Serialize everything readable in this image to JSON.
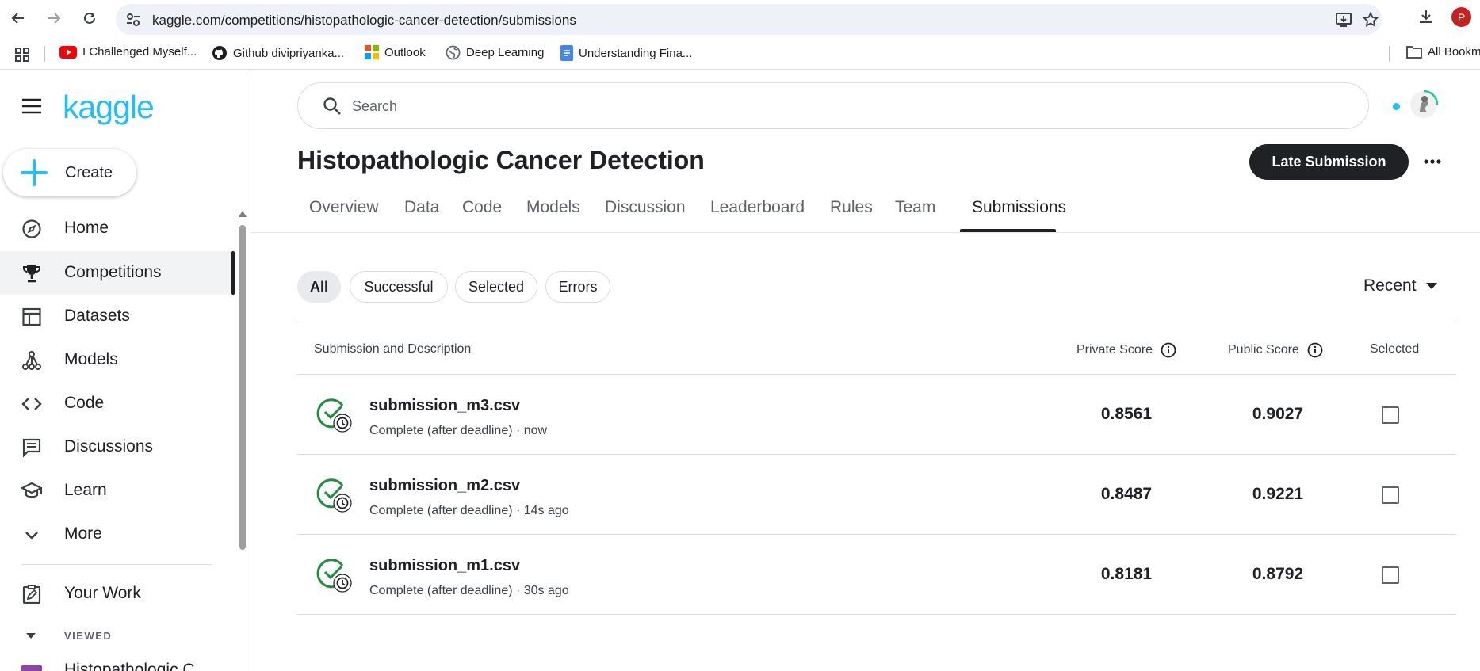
{
  "browser": {
    "url": "kaggle.com/competitions/histopathologic-cancer-detection/submissions",
    "profile_initial": "P",
    "bookmarks": [
      {
        "label": "I Challenged Myself...",
        "icon": "youtube-icon"
      },
      {
        "label": "Github divipriyanka...",
        "icon": "github-icon"
      },
      {
        "label": "Outlook",
        "icon": "microsoft-icon"
      },
      {
        "label": "Deep Learning",
        "icon": "globe-icon"
      },
      {
        "label": "Understanding Fina...",
        "icon": "docs-icon"
      }
    ],
    "all_bookmarks": "All Bookmarks"
  },
  "sidebar": {
    "logo": "kaggle",
    "create_label": "Create",
    "items": [
      {
        "label": "Home",
        "icon": "compass-icon"
      },
      {
        "label": "Competitions",
        "icon": "trophy-icon",
        "active": true
      },
      {
        "label": "Datasets",
        "icon": "table-icon"
      },
      {
        "label": "Models",
        "icon": "models-icon"
      },
      {
        "label": "Code",
        "icon": "code-icon"
      },
      {
        "label": "Discussions",
        "icon": "discussion-icon"
      },
      {
        "label": "Learn",
        "icon": "school-icon"
      },
      {
        "label": "More",
        "icon": "chevron-down-icon"
      }
    ],
    "your_work": "Your Work",
    "viewed_label": "VIEWED",
    "recent_item": "Histopathologic C..."
  },
  "search": {
    "placeholder": "Search"
  },
  "competition": {
    "title": "Histopathologic Cancer Detection",
    "late_submission_label": "Late Submission"
  },
  "tabs": [
    "Overview",
    "Data",
    "Code",
    "Models",
    "Discussion",
    "Leaderboard",
    "Rules",
    "Team",
    "Submissions"
  ],
  "active_tab": "Submissions",
  "filters": {
    "chips": [
      "All",
      "Successful",
      "Selected",
      "Errors"
    ],
    "active": "All",
    "sort_label": "Recent"
  },
  "table": {
    "headers": {
      "submission": "Submission and Description",
      "private": "Private Score",
      "public": "Public Score",
      "selected": "Selected"
    },
    "rows": [
      {
        "file": "submission_m3.csv",
        "desc": "Complete (after deadline) · now",
        "private": "0.8561",
        "public": "0.9027",
        "selected": false
      },
      {
        "file": "submission_m2.csv",
        "desc": "Complete (after deadline) · 14s ago",
        "private": "0.8487",
        "public": "0.9221",
        "selected": false
      },
      {
        "file": "submission_m1.csv",
        "desc": "Complete (after deadline) · 30s ago",
        "private": "0.8181",
        "public": "0.8792",
        "selected": false
      }
    ]
  },
  "colors": {
    "kaggle_blue": "#20beff",
    "success_green": "#1e8e3e",
    "dark": "#202124"
  }
}
